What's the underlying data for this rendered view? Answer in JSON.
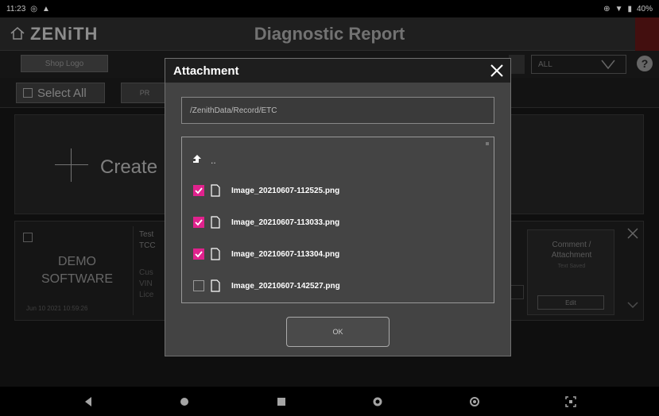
{
  "status_bar": {
    "time": "11:23",
    "battery": "40%"
  },
  "app_bar": {
    "brand": "ZENiTH",
    "title": "Diagnostic Report"
  },
  "toolbar": {
    "shop_logo_label": "Shop Logo",
    "filter_value": "ALL",
    "help_label": "?"
  },
  "select_bar": {
    "select_all_label": "Select All",
    "print_label": "PR"
  },
  "create_card": {
    "label": "Create"
  },
  "record": {
    "name_line1": "DEMO",
    "name_line2": "SOFTWARE",
    "date": "Jun 10 2021  10:59:26",
    "info_line1": "Test",
    "info_line2": "TCC",
    "info_line3": "Cus",
    "info_line4": "VIN",
    "info_line5": "Lice",
    "comment_title_1": "Comment /",
    "comment_title_2": "Attachment",
    "comment_sub": "Text Saved",
    "edit_label": "Edit"
  },
  "dialog": {
    "title": "Attachment",
    "path": "/ZenithData/Record/ETC",
    "up_label": "..",
    "files": [
      {
        "name": "Image_20210607-112525.png",
        "checked": true
      },
      {
        "name": "Image_20210607-113033.png",
        "checked": true
      },
      {
        "name": "Image_20210607-113304.png",
        "checked": true
      },
      {
        "name": "Image_20210607-142527.png",
        "checked": false
      }
    ],
    "ok_label": "OK"
  },
  "colors": {
    "checkbox_checked": "#e0228d",
    "dialog_header": "#1e1e1e",
    "dialog_body": "#434343"
  }
}
